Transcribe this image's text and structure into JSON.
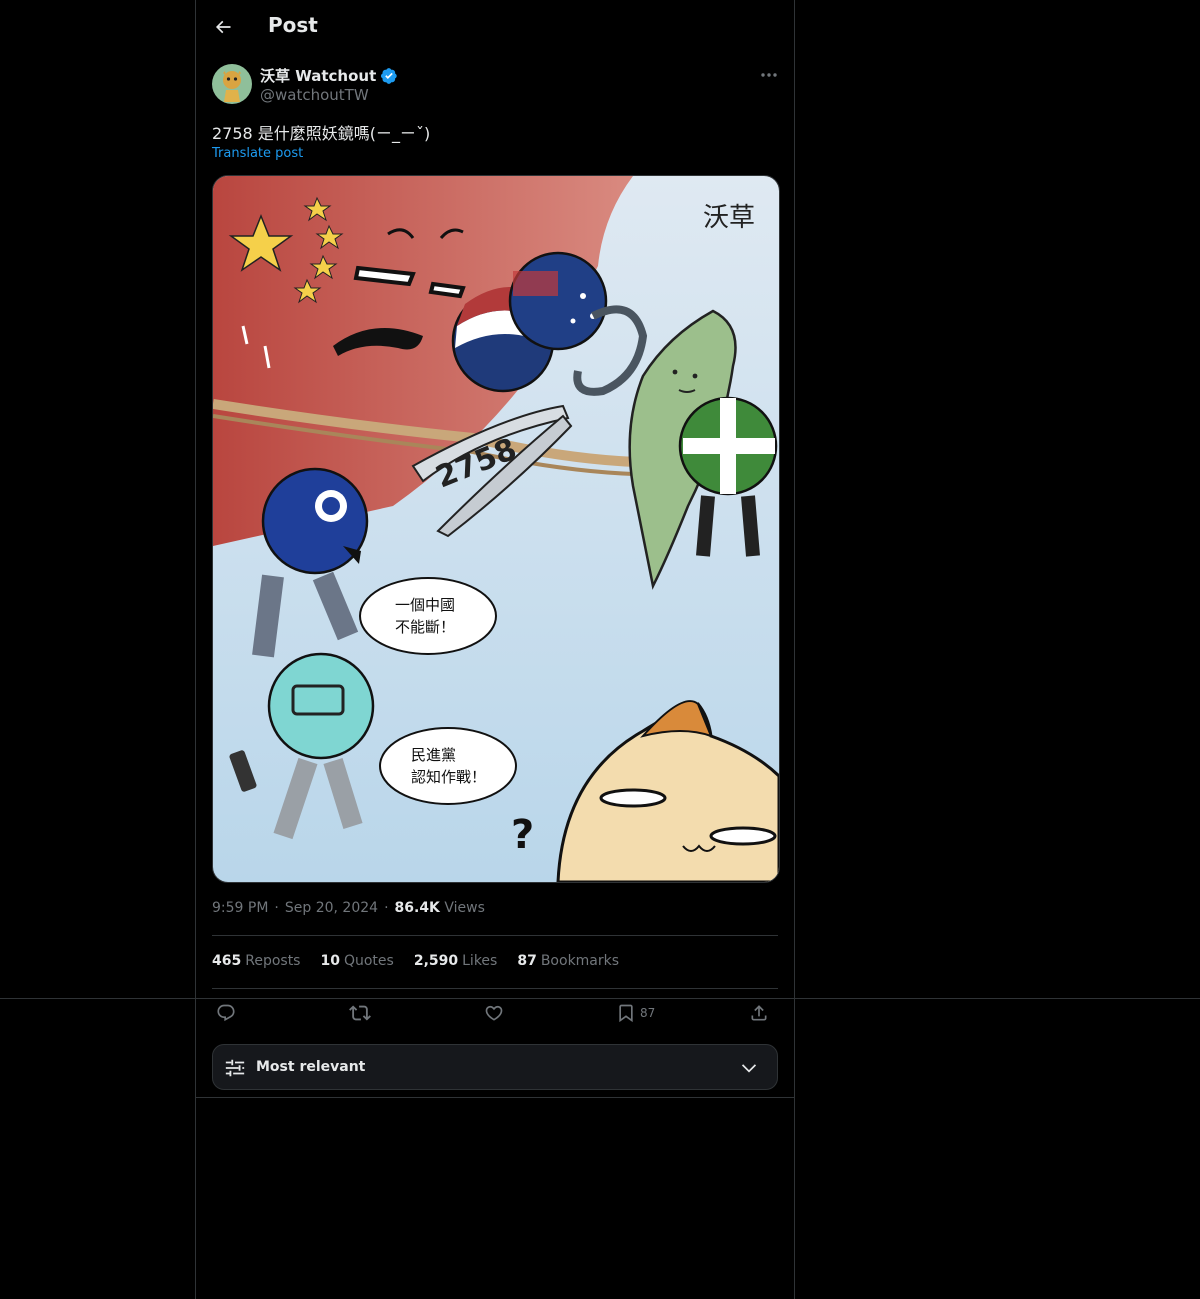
{
  "header": {
    "title": "Post"
  },
  "author": {
    "name": "沃草 Watchout",
    "handle": "@watchoutTW"
  },
  "post": {
    "text": "2758 是什麼照妖鏡嗎(ㄧ_ㄧˇ)",
    "translate_label": "Translate post"
  },
  "comic": {
    "artist_mark": "沃草",
    "scissors_label": "2758",
    "bubble1_line1": "一個中國",
    "bubble1_line2": "不能斷！",
    "bubble2_line1": "民進黨",
    "bubble2_line2": "認知作戰！",
    "question_mark": "?"
  },
  "meta": {
    "time": "9:59 PM",
    "sep": "·",
    "date": "Sep 20, 2024",
    "views_count": "86.4K",
    "views_label": "Views"
  },
  "stats": {
    "reposts_count": "465",
    "reposts_label": "Reposts",
    "quotes_count": "10",
    "quotes_label": "Quotes",
    "likes_count": "2,590",
    "likes_label": "Likes",
    "bookmarks_count": "87",
    "bookmarks_label": "Bookmarks"
  },
  "actions": {
    "bookmark_count": "87"
  },
  "replies_sort": {
    "label": "Most relevant"
  },
  "colors": {
    "accent": "#1d9bf0",
    "background": "#000000",
    "border": "#2f3336",
    "muted": "#71767b"
  }
}
